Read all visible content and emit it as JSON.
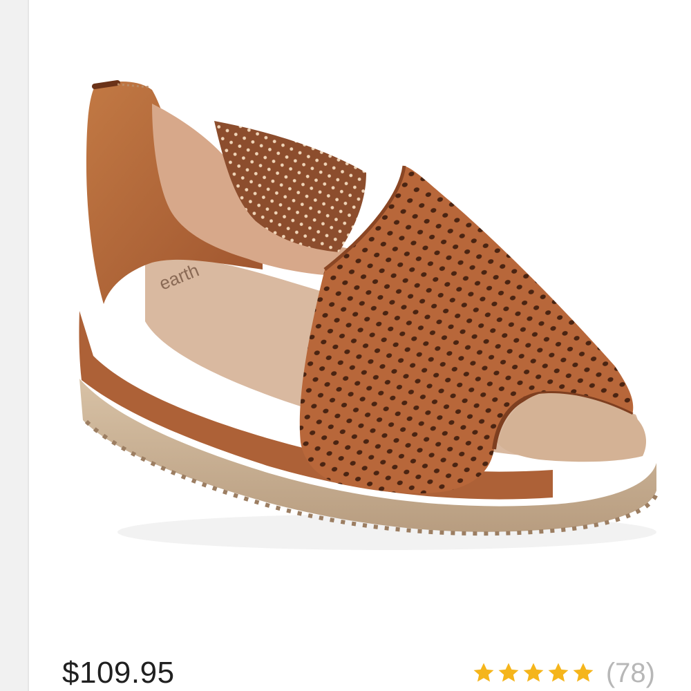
{
  "product": {
    "image_description": "sandal-product-image",
    "price": "$109.95",
    "rating": {
      "stars": 5,
      "star_color": "#f5b51b",
      "review_count": "(78)"
    },
    "brand_mark": "earth"
  },
  "colors": {
    "card_background": "#ffffff",
    "page_background": "#f1f1f1",
    "leather": "#b8673a",
    "leather_dark": "#9c512b",
    "sole": "#c7ad8f"
  }
}
